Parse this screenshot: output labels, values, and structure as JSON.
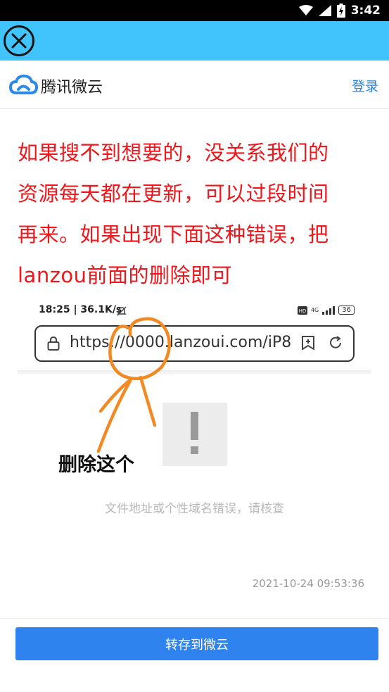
{
  "status_bar": {
    "time": "3:42"
  },
  "header": {
    "logo_text": "腾讯微云",
    "login_label": "登录"
  },
  "instruction": {
    "lines": [
      "如果搜不到想要的，没关系我们的",
      "资源每天都在更新，可以过段时间",
      "再来。如果出现下面这种错误，把",
      "lanzou前面的删除即可"
    ]
  },
  "embedded_screenshot": {
    "status_time": "18:25 | 36.1K/s",
    "network": "4G",
    "battery": "36",
    "url": "https://0000.lanzoui.com/iP8",
    "delete_label": "删除这个",
    "error_message": "文件地址或个性域名错误，请核查",
    "date": "2021-10-24 09:53:36"
  },
  "bottom": {
    "save_label": "转存到微云"
  },
  "colors": {
    "top_bar": "#41c4fb",
    "instruction_text": "#f0171c",
    "annotation": "#f28a24",
    "primary_button": "#2f83ef",
    "link": "#2a82e4"
  }
}
